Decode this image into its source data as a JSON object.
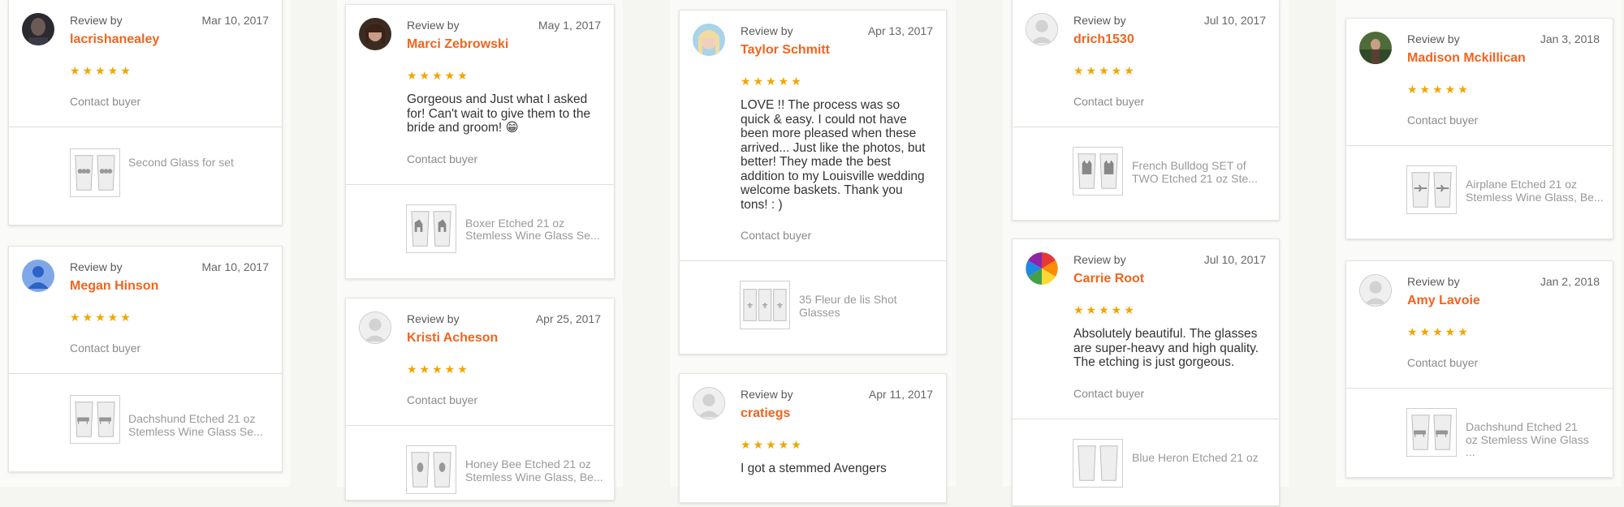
{
  "colors": {
    "accent": "#f1641e",
    "stars": "#f1a500"
  },
  "common": {
    "review_by": "Review by",
    "stars": "★★★★★",
    "contact": "Contact buyer"
  },
  "reviews": [
    {
      "name": "lacrishanealey",
      "date": "Mar 10, 2017",
      "text": "",
      "product": "Second Glass for set",
      "avatar": "photo-dark"
    },
    {
      "name": "Megan Hinson",
      "date": "Mar 10, 2017",
      "text": "",
      "product": "Dachshund Etched 21 oz Stemless Wine Glass Se...",
      "avatar": "default-blue"
    },
    {
      "name": "Marci Zebrowski",
      "date": "May 1, 2017",
      "text": "Gorgeous and Just what I asked for! Can't wait to give them to the bride and groom! 😁",
      "product": "Boxer Etched 21 oz Stemless Wine Glass Se...",
      "avatar": "photo-woman"
    },
    {
      "name": "Kristi Acheson",
      "date": "Apr 25, 2017",
      "text": "",
      "product": "Honey Bee Etched 21 oz Stemless Wine Glass, Be...",
      "avatar": "default-gray"
    },
    {
      "name": "Taylor Schmitt",
      "date": "Apr 13, 2017",
      "text": "LOVE !! The process was so quick & easy.  I could not have been more pleased when these arrived... Just like the photos, but better! They made the best addition to my Louisville wedding welcome baskets. Thank you tons! : )",
      "product": "35 Fleur de lis Shot Glasses",
      "avatar": "photo-blonde"
    },
    {
      "name": "cratiegs",
      "date": "Apr 11, 2017",
      "text": "I got a stemmed Avengers",
      "product": "",
      "avatar": "default-gray"
    },
    {
      "name": "drich1530",
      "date": "Jul 10, 2017",
      "text": "",
      "product": "French Bulldog SET of TWO Etched 21 oz Ste...",
      "avatar": "default-gray"
    },
    {
      "name": "Carrie Root",
      "date": "Jul 10, 2017",
      "text": "Absolutely beautiful. The glasses are super-heavy and high quality. The etching is just gorgeous.",
      "product": "Blue Heron Etched 21 oz",
      "avatar": "rainbow"
    },
    {
      "name": "Madison Mckillican",
      "date": "Jan 3, 2018",
      "text": "",
      "product": "Airplane Etched 21 oz Stemless Wine Glass, Be...",
      "avatar": "photo-outdoor"
    },
    {
      "name": "Amy Lavoie",
      "date": "Jan 2, 2018",
      "text": "",
      "product": "Dachshund Etched 21 oz Stemless Wine Glass ...",
      "avatar": "default-gray"
    }
  ]
}
